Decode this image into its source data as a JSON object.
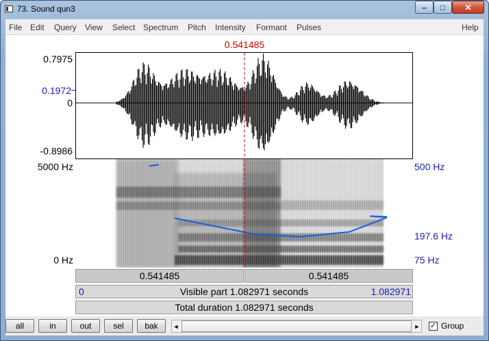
{
  "window": {
    "title": "73. Sound qun3",
    "minimize_glyph": "–",
    "maximize_glyph": "□",
    "close_glyph": "✕"
  },
  "menu": {
    "items": [
      "File",
      "Edit",
      "Query",
      "View",
      "Select",
      "Spectrum",
      "Pitch",
      "Intensity",
      "Formant",
      "Pulses"
    ],
    "help": "Help"
  },
  "cursor": {
    "time_label": "0.541485",
    "time_s": 0.541485
  },
  "waveform": {
    "y_max": "0.7975",
    "y_cursor": "0.1972",
    "y_zero": "0",
    "y_min": "-0.8986"
  },
  "spectrogram": {
    "freq_top": "5000 Hz",
    "freq_bottom": "0 Hz",
    "pitch_top": "500 Hz",
    "pitch_cursor": "197.6 Hz",
    "pitch_bottom": "75 Hz"
  },
  "time_bars": {
    "left_segment": "0.541485",
    "right_segment": "0.541485",
    "visible_start": "0",
    "visible_label": "Visible part 1.082971 seconds",
    "visible_end": "1.082971",
    "total_label": "Total duration 1.082971 seconds"
  },
  "buttons": {
    "all": "all",
    "in": "in",
    "out": "out",
    "sel": "sel",
    "bak": "bak"
  },
  "scroll": {
    "left_arrow": "◄",
    "right_arrow": "►"
  },
  "group": {
    "label": "Group",
    "checked": true,
    "check_glyph": "✓"
  },
  "colors": {
    "cursor": "#d40000",
    "pitch_curve": "#1a5fd6",
    "pitch_labels": "#1b1bb7"
  }
}
